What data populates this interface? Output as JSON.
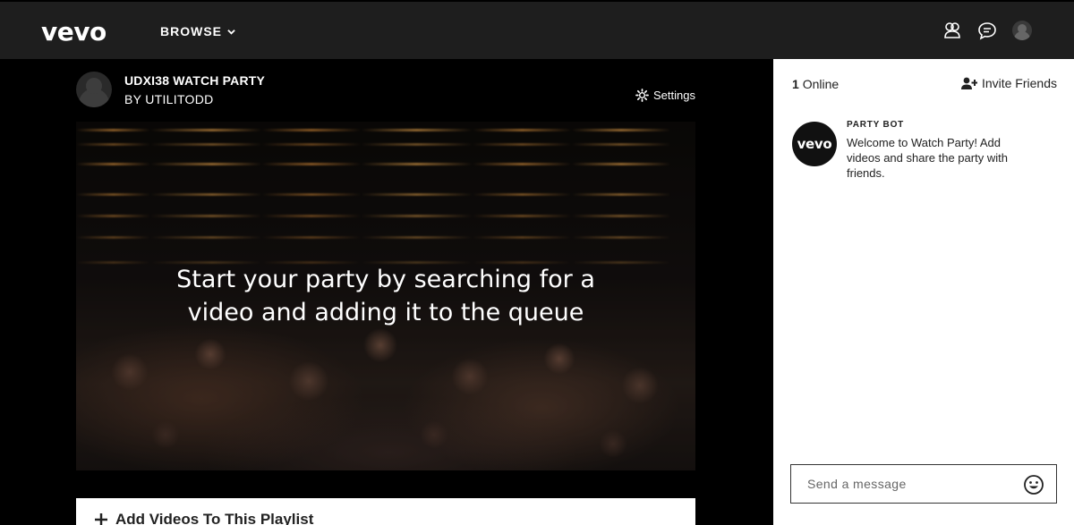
{
  "header": {
    "logo": "vevo",
    "browse_label": "BROWSE"
  },
  "party": {
    "title": "UDXI38 WATCH PARTY",
    "by": "BY UTILITODD",
    "settings_label": "Settings",
    "hero_text_line1": "Start your party by searching for a",
    "hero_text_line2": "video and adding it to the queue",
    "add_videos_label": "Add Videos To This Playlist"
  },
  "sidebar": {
    "online_count": "1",
    "online_label": "Online",
    "invite_label": "Invite Friends",
    "message": {
      "author": "PARTY BOT",
      "avatar_text": "vevo",
      "text": "Welcome to Watch Party! Add videos and share the party with friends."
    },
    "input_placeholder": "Send a message"
  },
  "icons": {
    "top_right": [
      "friends-icon",
      "chat-icon",
      "user-avatar"
    ],
    "settings": "gear-icon",
    "invite": "add-user-icon",
    "add": "plus-icon",
    "emoji": "smiley-icon"
  },
  "colors": {
    "topbar": "#1e1e1e",
    "background": "#000000",
    "panel": "#ffffff"
  }
}
